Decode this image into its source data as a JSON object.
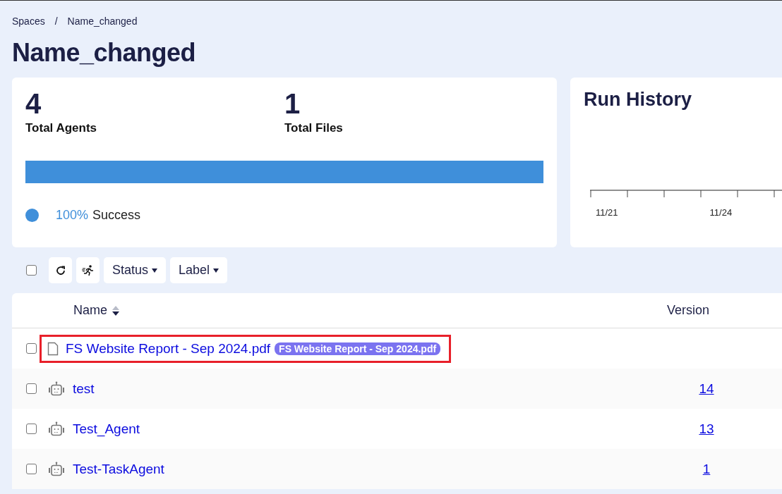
{
  "breadcrumb": [
    "Spaces",
    "Name_changed"
  ],
  "breadcrumb_separator": "/",
  "title": "Name_changed",
  "stats": [
    {
      "value": "4",
      "label": "Total Agents"
    },
    {
      "value": "1",
      "label": "Total Files"
    }
  ],
  "progress": {
    "level": 1,
    "percent": "100%",
    "label": "Success",
    "color": "#3f8fda"
  },
  "run_history": {
    "title": "Run History",
    "axis_labels": [
      "11/21",
      "11/24"
    ]
  },
  "toolbar": {
    "checked": false,
    "filters": [
      "Status",
      "Label"
    ]
  },
  "table": {
    "columns": [
      "Name",
      "Version"
    ],
    "rows": [
      {
        "kind": "file",
        "name": "FS Website Report - Sep 2024.pdf",
        "tag": "FS Website Report - Sep 2024.pdf",
        "version": "",
        "checked": false,
        "highlighted": true
      },
      {
        "kind": "agent",
        "name": "test",
        "version": "14",
        "checked": false,
        "highlighted": false
      },
      {
        "kind": "agent",
        "name": "Test_Agent",
        "version": "13",
        "checked": false,
        "highlighted": false
      },
      {
        "kind": "agent",
        "name": "Test-TaskAgent",
        "version": "1",
        "checked": false,
        "highlighted": false
      }
    ]
  }
}
